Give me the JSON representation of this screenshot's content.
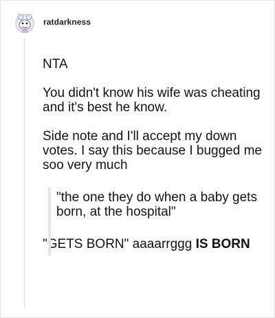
{
  "post": {
    "username": "ratdarkness",
    "avatar_icon": "cartoon-creature-avatar-icon",
    "paragraphs": {
      "p1": "NTA",
      "p2": "You didn't know his wife was cheating and it's best he know.",
      "p3": "Side note and I'll accept my down votes. I say this because I bugged me soo very much"
    },
    "quote": "\"the one they do when a baby gets born, at the hospital\"",
    "final": {
      "text": "\"GETS BORN\" aaaarrggg ",
      "bold": "IS BORN"
    }
  },
  "colors": {
    "text": "#111111",
    "thread_line": "#d9d9d9",
    "quote_bar": "#e6e6e6"
  }
}
